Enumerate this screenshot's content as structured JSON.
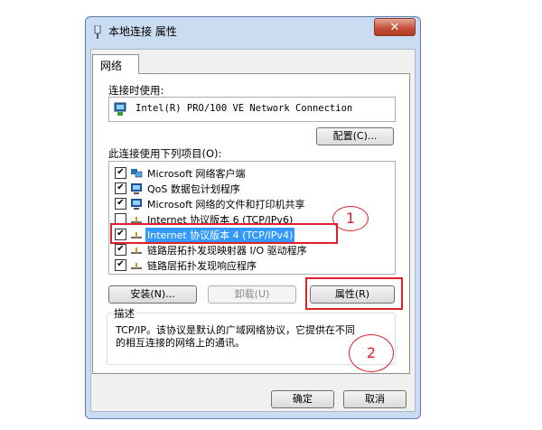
{
  "window": {
    "title": "本地连接 属性",
    "close_glyph": "✕"
  },
  "tab": {
    "label": "网络"
  },
  "connect_using": {
    "label": "连接时使用:",
    "device": "Intel(R) PRO/100 VE Network Connection",
    "configure_button": "配置(C)..."
  },
  "items_section": {
    "label": "此连接使用下列项目(O):",
    "items": [
      {
        "label": "Microsoft 网络客户端",
        "checked": true,
        "icon": "network-client-icon"
      },
      {
        "label": "QoS 数据包计划程序",
        "checked": true,
        "icon": "qos-icon"
      },
      {
        "label": "Microsoft 网络的文件和打印机共享",
        "checked": true,
        "icon": "file-share-icon"
      },
      {
        "label": "Internet 协议版本 6 (TCP/IPv6)",
        "checked": false,
        "icon": "protocol-icon"
      },
      {
        "label": "Internet 协议版本 4 (TCP/IPv4)",
        "checked": true,
        "icon": "protocol-icon",
        "selected": true
      },
      {
        "label": "链路层拓扑发现映射器 I/O 驱动程序",
        "checked": true,
        "icon": "protocol-icon"
      },
      {
        "label": "链路层拓扑发现响应程序",
        "checked": true,
        "icon": "protocol-icon"
      }
    ]
  },
  "buttons": {
    "install": "安装(N)...",
    "uninstall": "卸载(U)",
    "properties": "属性(R)",
    "ok": "确定",
    "cancel": "取消"
  },
  "description": {
    "legend": "描述",
    "text_line1": "TCP/IP。该协议是默认的广域网络协议，它提供在不同",
    "text_line2": "的相互连接的网络上的通讯。"
  },
  "annotations": {
    "marker1": "1",
    "marker2": "2",
    "color": "#e0202a"
  }
}
